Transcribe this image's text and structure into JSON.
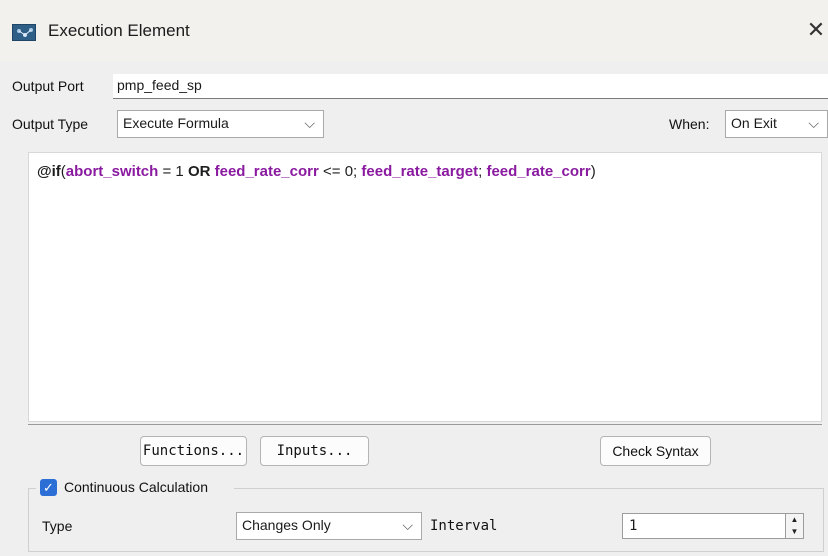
{
  "window": {
    "title": "Execution Element",
    "close_glyph": "✕",
    "app_icon": "execution-element-app-icon"
  },
  "output_port": {
    "label": "Output Port",
    "value": "pmp_feed_sp"
  },
  "output_type": {
    "label": "Output Type",
    "selected": "Execute Formula",
    "chevron": "⌵"
  },
  "when": {
    "label": "When:",
    "selected": "On Exit",
    "chevron": "⌵"
  },
  "formula": {
    "fn": "@if",
    "open_paren": "(",
    "var1": "abort_switch",
    "eq": " = 1 ",
    "or": "OR",
    "var2": " feed_rate_corr",
    "le": " <= 0; ",
    "var3": "feed_rate_target",
    "semi": "; ",
    "var4": "feed_rate_corr",
    "close_paren": ")"
  },
  "buttons": {
    "functions": "Functions...",
    "inputs": "Inputs...",
    "check_syntax": "Check Syntax"
  },
  "continuous_calculation": {
    "label": "Continuous Calculation",
    "checked": true,
    "check_glyph": "✓"
  },
  "type_field": {
    "label": "Type",
    "selected": "Changes Only",
    "chevron": "⌵"
  },
  "interval": {
    "label": "Interval",
    "value": "1",
    "up_glyph": "▲",
    "down_glyph": "▼"
  },
  "colors": {
    "variable": "#8a1aa0",
    "checkbox": "#2b6fd6",
    "title_bar": "#f3f1ee",
    "dialog_bg": "#efefef"
  }
}
